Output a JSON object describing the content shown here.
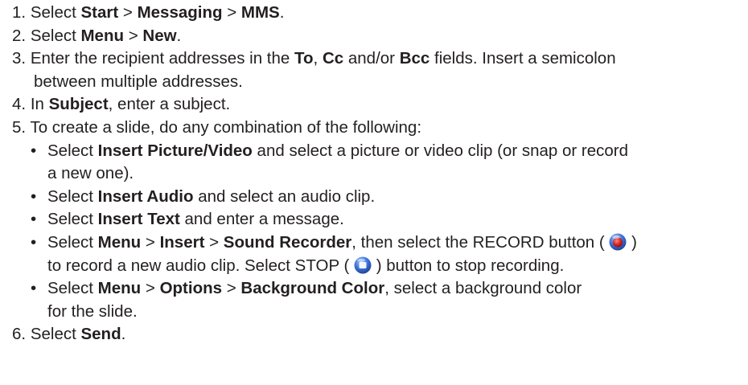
{
  "steps": [
    {
      "num": "1.",
      "s1": "Select ",
      "b1": "Start",
      "s2": " > ",
      "b2": "Messaging",
      "s3": " > ",
      "b3": "MMS",
      "s4": "."
    },
    {
      "num": "2.",
      "s1": "Select ",
      "b1": "Menu",
      "s2": " > ",
      "b2": "New",
      "s3": "."
    },
    {
      "num": "3.",
      "s1": "Enter the recipient addresses in the ",
      "b1": "To",
      "s2": ", ",
      "b2": "Cc",
      "s3": " and/or ",
      "b3": "Bcc",
      "s4": " fields. Insert a semicolon",
      "cont": "between multiple addresses."
    },
    {
      "num": "4.",
      "s1": "In ",
      "b1": "Subject",
      "s2": ", enter a subject."
    },
    {
      "num": "5.",
      "s1": "To create a slide, do any combination of the following:",
      "bullets": [
        {
          "dot": "•",
          "s1": "Select ",
          "b1": "Insert Picture/Video",
          "s2": " and select a picture or video clip (or snap or record",
          "cont": "a new one)."
        },
        {
          "dot": "•",
          "s1": "Select ",
          "b1": "Insert Audio",
          "s2": " and select an audio clip."
        },
        {
          "dot": "•",
          "s1": "Select ",
          "b1": "Insert Text",
          "s2": " and enter a message."
        },
        {
          "dot": "•",
          "s1": "Select ",
          "b1": "Menu",
          "s2": " > ",
          "b2": "Insert",
          "s3": " > ",
          "b3": "Sound Recorder",
          "s4": ", then select the RECORD button (",
          "s5": ")",
          "cont1": "to record a new audio clip. Select STOP (",
          "cont2": ") button to stop recording.",
          "record_icon": "record-button-icon",
          "stop_icon": "stop-button-icon"
        },
        {
          "dot": "•",
          "s1": "Select ",
          "b1": "Menu",
          "s2": " > ",
          "b2": "Options",
          "s3": " > ",
          "b3": "Background Color",
          "s4": ", select a background color",
          "cont": "for the slide."
        }
      ]
    },
    {
      "num": "6.",
      "s1": "Select ",
      "b1": "Send",
      "s2": "."
    }
  ],
  "colors": {
    "text": "#231f20",
    "record_red": "#d42020",
    "icon_blue": "#3b6fd4"
  }
}
